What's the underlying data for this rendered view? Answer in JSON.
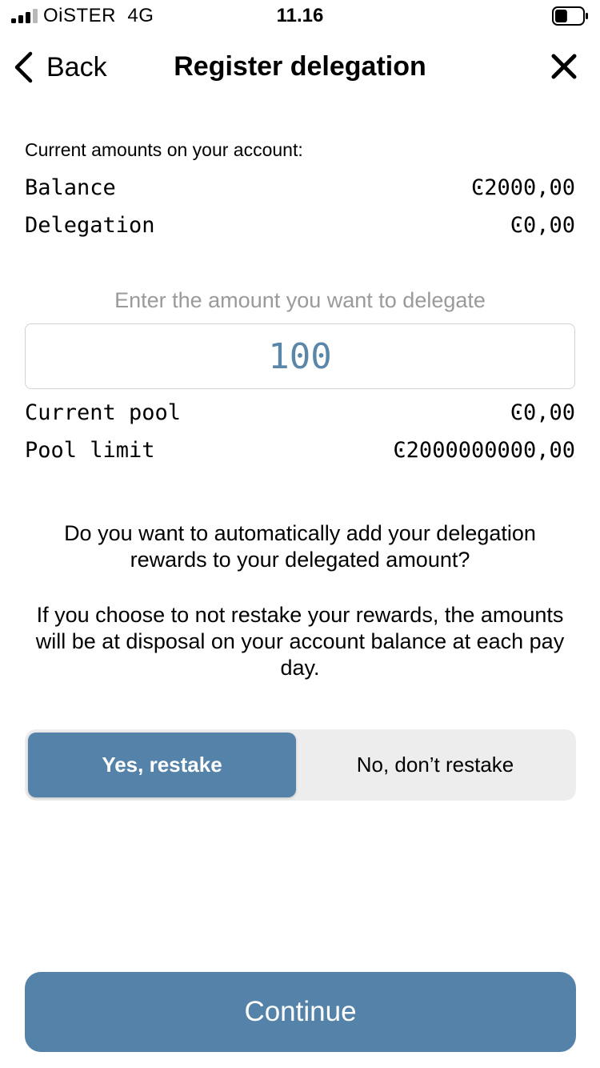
{
  "status_bar": {
    "carrier": "OiSTER  4G",
    "time": "11.16",
    "battery_level": 0.45
  },
  "nav": {
    "back_label": "Back",
    "title": "Register delegation"
  },
  "account": {
    "heading": "Current amounts on your account:",
    "rows": [
      {
        "label": "Balance",
        "value": "Ͼ2000,00"
      },
      {
        "label": "Delegation",
        "value": "Ͼ0,00"
      }
    ]
  },
  "amount": {
    "prompt": "Enter the amount you want to delegate",
    "value": "100"
  },
  "pool": {
    "rows": [
      {
        "label": "Current pool",
        "value": "Ͼ0,00"
      },
      {
        "label": "Pool limit",
        "value": "Ͼ2000000000,00"
      }
    ]
  },
  "restake": {
    "question": "Do you want to automatically add your delegation rewards to your delegated amount?",
    "explanation": "If you choose to not restake your rewards, the amounts will be at disposal on your account balance at each pay day.",
    "yes_label": "Yes, restake",
    "no_label": "No, don’t restake",
    "selected": "yes"
  },
  "continue_label": "Continue",
  "colors": {
    "accent": "#5482a8",
    "input_text": "#5a86a8",
    "segment_bg": "#ededed",
    "prompt_text": "#9a9a9a"
  }
}
